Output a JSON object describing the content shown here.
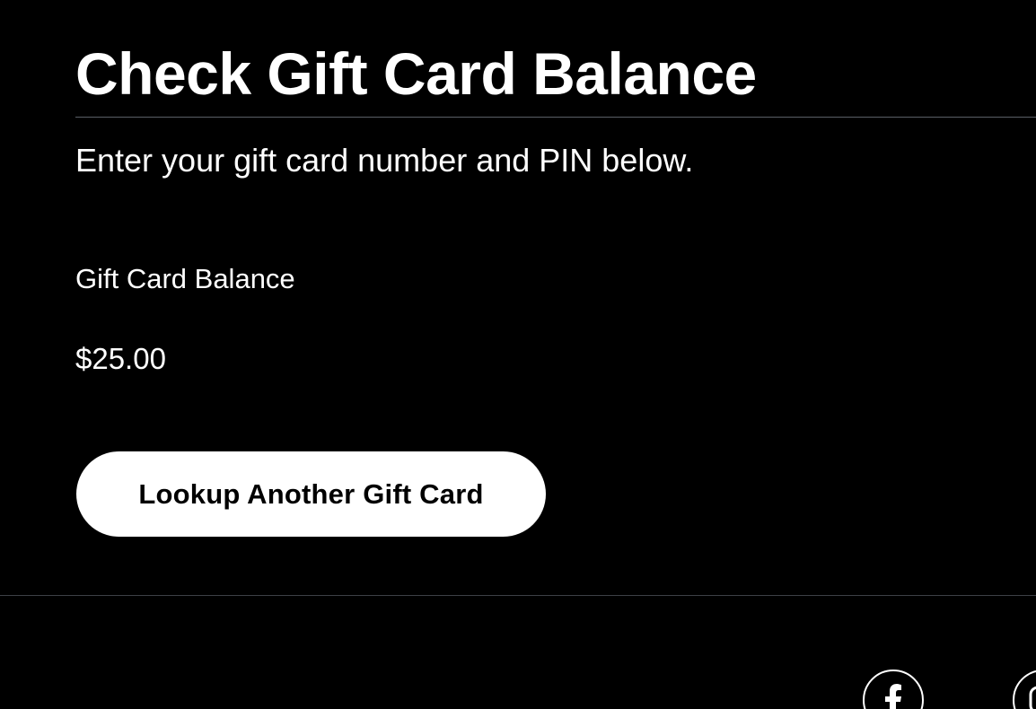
{
  "page": {
    "title": "Check Gift Card Balance",
    "subtitle": "Enter your gift card number and PIN below."
  },
  "balance": {
    "label": "Gift Card Balance",
    "value": "$25.00"
  },
  "actions": {
    "lookup_another_label": "Lookup Another Gift Card"
  },
  "footer": {
    "social_icons": [
      "facebook-icon",
      "instagram-icon"
    ]
  },
  "colors": {
    "background": "#000000",
    "text": "#ffffff",
    "button_bg": "#ffffff",
    "button_text": "#000000",
    "divider": "#5a5f66"
  }
}
